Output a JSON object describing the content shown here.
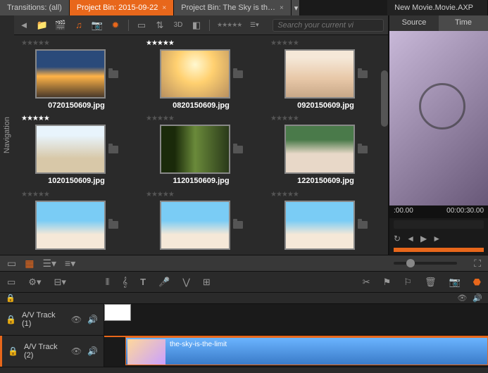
{
  "tabs": {
    "transitions": "Transitions: (all)",
    "bin1": "Project Bin: 2015-09-22",
    "bin2": "Project Bin: The Sky is th…"
  },
  "project_title": "New Movie.Movie.AXP",
  "search": {
    "placeholder": "Search your current vi"
  },
  "toolbar": {
    "view3d": "3D"
  },
  "nav_label": "Navigation",
  "items": [
    {
      "stars": "★★★★★",
      "dim": true,
      "file": "0720150609.jpg"
    },
    {
      "stars": "★★★★★",
      "dim": false,
      "file": "0820150609.jpg"
    },
    {
      "stars": "★★★★★",
      "dim": true,
      "file": "0920150609.jpg"
    },
    {
      "stars": "★★★★★",
      "dim": false,
      "file": "1020150609.jpg"
    },
    {
      "stars": "★★★★★",
      "dim": true,
      "file": "1120150609.jpg"
    },
    {
      "stars": "★★★★★",
      "dim": true,
      "file": "1220150609.jpg"
    },
    {
      "stars": "★★★★★",
      "dim": true,
      "file": ""
    },
    {
      "stars": "★★★★★",
      "dim": true,
      "file": ""
    },
    {
      "stars": "★★★★★",
      "dim": true,
      "file": ""
    }
  ],
  "preview": {
    "source_tab": "Source",
    "timeline_tab": "Time",
    "tc_start": ":00.00",
    "tc_end": "00:00:30.00"
  },
  "tracks": {
    "t1": "A/V Track (1)",
    "t2": "A/V Track (2)",
    "clip_label": "the-sky-is-the-limit"
  }
}
